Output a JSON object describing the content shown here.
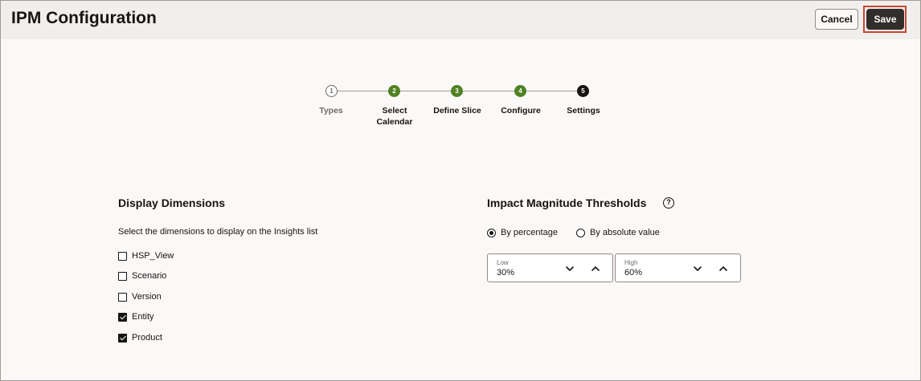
{
  "header": {
    "title": "IPM Configuration",
    "cancel_label": "Cancel",
    "save_label": "Save"
  },
  "stepper": {
    "steps": [
      {
        "number": "1",
        "label": "Types",
        "state": "todo"
      },
      {
        "number": "2",
        "label": "Select Calendar",
        "state": "done"
      },
      {
        "number": "3",
        "label": "Define Slice",
        "state": "done"
      },
      {
        "number": "4",
        "label": "Configure",
        "state": "done"
      },
      {
        "number": "5",
        "label": "Settings",
        "state": "current"
      }
    ]
  },
  "display_dimensions": {
    "title": "Display Dimensions",
    "description": "Select the dimensions to display on the Insights list",
    "items": [
      {
        "label": "HSP_View",
        "checked": false
      },
      {
        "label": "Scenario",
        "checked": false
      },
      {
        "label": "Version",
        "checked": false
      },
      {
        "label": "Entity",
        "checked": true
      },
      {
        "label": "Product",
        "checked": true
      }
    ]
  },
  "thresholds": {
    "title": "Impact Magnitude Thresholds",
    "help_icon": "?",
    "options": [
      {
        "label": "By percentage",
        "selected": true
      },
      {
        "label": "By absolute value",
        "selected": false
      }
    ],
    "low": {
      "label": "Low",
      "value": "30%"
    },
    "high": {
      "label": "High",
      "value": "60%"
    }
  },
  "colors": {
    "done_step": "#508223",
    "current_step": "#161513",
    "save_outline": "#c74634",
    "save_button": "#312d2a"
  }
}
